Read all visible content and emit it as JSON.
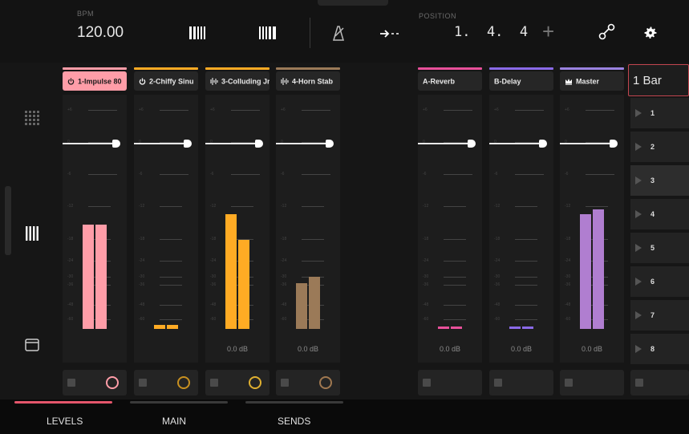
{
  "header": {
    "bpm_label": "BPM",
    "bpm_value": "120.00",
    "position_label": "POSITION",
    "position_value": "1.  4.  4",
    "plus_glyph": "+"
  },
  "sidebar": {
    "items": [
      {
        "icon": "grid-icon"
      },
      {
        "icon": "mixer-columns-icon"
      },
      {
        "icon": "window-icon"
      }
    ]
  },
  "channels": [
    {
      "name": "1-Impulse 80",
      "type_icon": "power-icon",
      "color": "#ff9da8",
      "selected": true,
      "meter": [
        0.48,
        0.48
      ],
      "db": "",
      "fader": 0.79,
      "knob_color": "#ff9da8"
    },
    {
      "name": "2-Chiffy Sinu",
      "type_icon": "power-icon",
      "color": "#ffab24",
      "selected": false,
      "meter": [
        0.02,
        0.02
      ],
      "db": "",
      "fader": 0.79,
      "knob_color": "#c89020"
    },
    {
      "name": "3-Colluding Jr",
      "type_icon": "wave-icon",
      "color": "#ffab24",
      "selected": false,
      "meter": [
        0.53,
        0.41
      ],
      "db": "0.0 dB",
      "fader": 0.79,
      "knob_color": "#e0b030"
    },
    {
      "name": "4-Horn Stab",
      "type_icon": "wave-icon",
      "color": "#9b7a58",
      "selected": false,
      "meter": [
        0.21,
        0.24
      ],
      "db": "0.0 dB",
      "fader": 0.79,
      "knob_color": "#a07850"
    }
  ],
  "returns": [
    {
      "name": "A-Reverb",
      "type_icon": "",
      "color": "#e8509a",
      "meter": [
        0.01,
        0.01
      ],
      "db": "0.0 dB",
      "fader": 0.79,
      "bar_color": "#e8509a"
    },
    {
      "name": "B-Delay",
      "type_icon": "",
      "color": "#8a6ae8",
      "meter": [
        0.01,
        0.01
      ],
      "db": "0.0 dB",
      "fader": 0.79,
      "bar_color": "#8a6ae8"
    },
    {
      "name": "Master",
      "type_icon": "crown-icon",
      "color": "#9a82e0",
      "meter": [
        0.53,
        0.55
      ],
      "db": "0.0 dB",
      "fader": 0.79,
      "bar_color": "#b07ed0"
    }
  ],
  "slices": {
    "header": "1 Bar",
    "items": [
      "1",
      "2",
      "3",
      "4",
      "5",
      "6",
      "7",
      "8"
    ],
    "active_index": 2
  },
  "bottom_tabs": [
    {
      "label": "LEVELS",
      "active": true,
      "color": "#e5566b"
    },
    {
      "label": "MAIN",
      "active": false,
      "color": "#3a3a3a"
    },
    {
      "label": "SENDS",
      "active": false,
      "color": "#3a3a3a"
    }
  ],
  "scale_labels": [
    "+6",
    "0",
    "-6",
    "-12",
    "-18",
    "-24",
    "-30",
    "-36",
    "-48",
    "-60"
  ],
  "colors": {
    "background": "#161616",
    "accent": "#e5566b"
  }
}
